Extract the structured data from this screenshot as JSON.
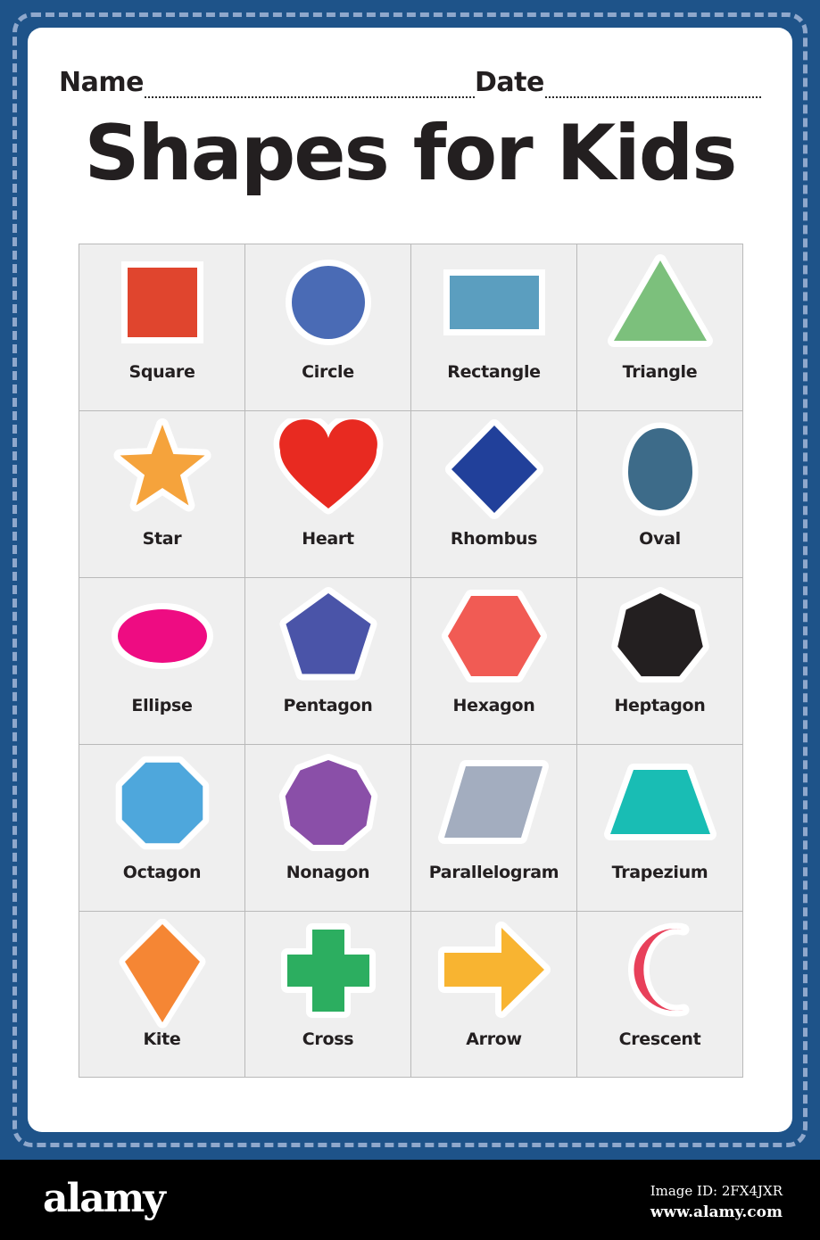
{
  "worksheet": {
    "title": "Shapes for Kids",
    "name_label": "Name",
    "date_label": "Date"
  },
  "colors": {
    "border_navy": "#1E5389",
    "border_dash": "#8FA8CC",
    "card_white": "#FFFFFF",
    "cell_bg": "#EFEFEF",
    "cell_border": "#B9B9B9",
    "text_dark": "#231F20",
    "shape_outline": "#FFFFFF"
  },
  "shapes": [
    {
      "label": "Square",
      "icon": "square-shape-icon",
      "color": "#E0452E"
    },
    {
      "label": "Circle",
      "icon": "circle-shape-icon",
      "color": "#4A6BB5"
    },
    {
      "label": "Rectangle",
      "icon": "rectangle-shape-icon",
      "color": "#5B9EBF"
    },
    {
      "label": "Triangle",
      "icon": "triangle-shape-icon",
      "color": "#7CC07C"
    },
    {
      "label": "Star",
      "icon": "star-shape-icon",
      "color": "#F5A33C"
    },
    {
      "label": "Heart",
      "icon": "heart-shape-icon",
      "color": "#E82A21"
    },
    {
      "label": "Rhombus",
      "icon": "rhombus-shape-icon",
      "color": "#21409A"
    },
    {
      "label": "Oval",
      "icon": "oval-shape-icon",
      "color": "#3D6B89"
    },
    {
      "label": "Ellipse",
      "icon": "ellipse-shape-icon",
      "color": "#EE0C82"
    },
    {
      "label": "Pentagon",
      "icon": "pentagon-shape-icon",
      "color": "#4A54A8"
    },
    {
      "label": "Hexagon",
      "icon": "hexagon-shape-icon",
      "color": "#F15B54"
    },
    {
      "label": "Heptagon",
      "icon": "heptagon-shape-icon",
      "color": "#231F20"
    },
    {
      "label": "Octagon",
      "icon": "octagon-shape-icon",
      "color": "#4EA7DC"
    },
    {
      "label": "Nonagon",
      "icon": "nonagon-shape-icon",
      "color": "#8A4FA8"
    },
    {
      "label": "Parallelogram",
      "icon": "parallelogram-shape-icon",
      "color": "#A3ADBF"
    },
    {
      "label": "Trapezium",
      "icon": "trapezium-shape-icon",
      "color": "#19BDB4"
    },
    {
      "label": "Kite",
      "icon": "kite-shape-icon",
      "color": "#F58634"
    },
    {
      "label": "Cross",
      "icon": "cross-shape-icon",
      "color": "#2CAE60"
    },
    {
      "label": "Arrow",
      "icon": "arrow-shape-icon",
      "color": "#F8B431"
    },
    {
      "label": "Crescent",
      "icon": "crescent-shape-icon",
      "color": "#E8405A"
    }
  ],
  "footer": {
    "logo": "alamy",
    "image_id": "Image ID: 2FX4JXR",
    "url": "www.alamy.com"
  }
}
